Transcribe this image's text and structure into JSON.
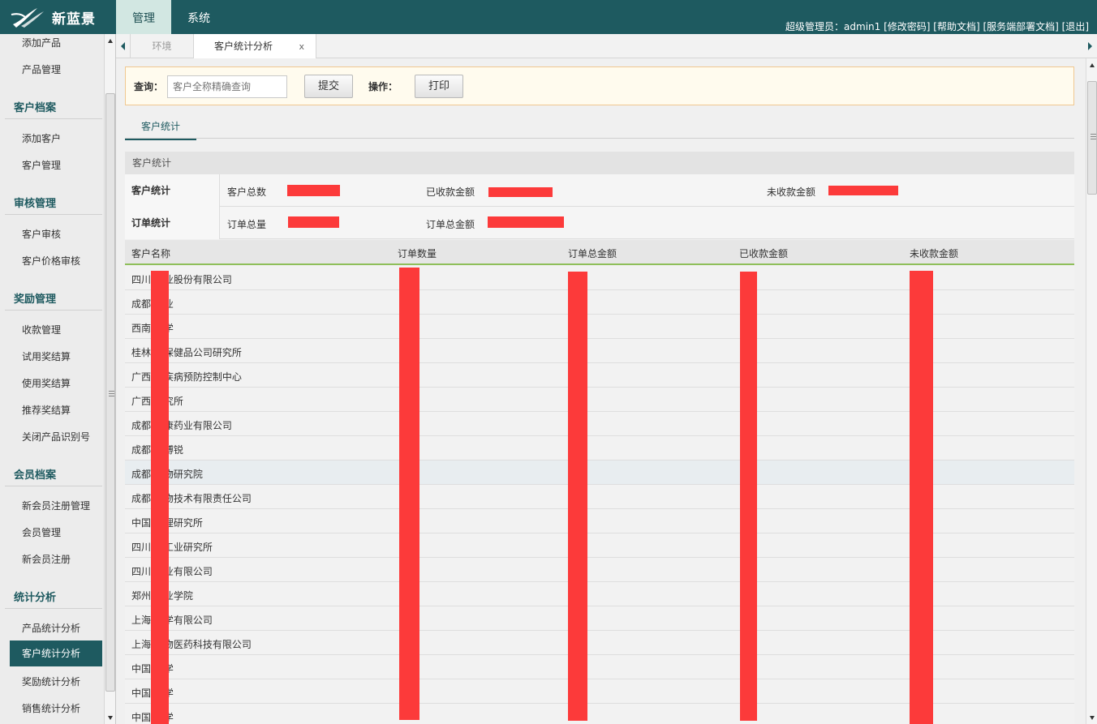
{
  "brand": {
    "name": "新蓝景"
  },
  "nav": {
    "tabs": [
      {
        "label": "管理"
      },
      {
        "label": "系统"
      }
    ]
  },
  "userbar": {
    "text": "超级管理员：admin1 [修改密码] [帮助文档] [服务端部署文档] [退出]"
  },
  "sidebar": {
    "items": [
      "添加产品",
      "产品管理",
      "客户档案",
      "添加客户",
      "客户管理",
      "审核管理",
      "客户审核",
      "客户价格审核",
      "奖励管理",
      "收款管理",
      "试用奖结算",
      "使用奖结算",
      "推荐奖结算",
      "关闭产品识别号",
      "会员档案",
      "新会员注册管理",
      "会员管理",
      "新会员注册",
      "统计分析",
      "产品统计分析",
      "客户统计分析",
      "奖励统计分析",
      "销售统计分析"
    ]
  },
  "tabs": {
    "inactive": "环境",
    "active": "客户统计分析",
    "close": "x"
  },
  "query": {
    "label": "查询：",
    "placeholder": "客户全称精确查询",
    "submit": "提交",
    "op_label": "操作：",
    "print": "打印"
  },
  "subtab": "客户统计",
  "stats": {
    "header": "客户统计",
    "row1": {
      "cat": "客户统计",
      "l1": "客户总数",
      "l2": "已收款金额",
      "l3": "未收款金额"
    },
    "row2": {
      "cat": "订单统计",
      "l1": "订单总量",
      "l2": "订单总金额"
    }
  },
  "table": {
    "columns": [
      "客户名称",
      "订单数量",
      "订单总金额",
      "已收款金额",
      "未收款金额"
    ],
    "rows": [
      "四川 药业股份有限公司",
      "成都 药业",
      "西南 大学",
      "桂林 可保健品公司研究所",
      "广西 市疾病预防控制中心",
      "广西 研究所",
      "成都 利康药业有限公司",
      "成都 海博锐",
      "成都 药物研究院",
      "成都 生物技术有限责任公司",
      "中国 物理研究所",
      "四川 素工业研究所",
      "四川 药业有限公司",
      "郑州 工业学院",
      "上海 化学有限公司",
      "上海 生物医药科技有限公司",
      "中国 大学",
      "中国 大学",
      "中国 大学"
    ]
  },
  "colors": {
    "primary": "#1e5a60",
    "redaction": "#fc3a3a",
    "query_bg": "#fffbee"
  }
}
